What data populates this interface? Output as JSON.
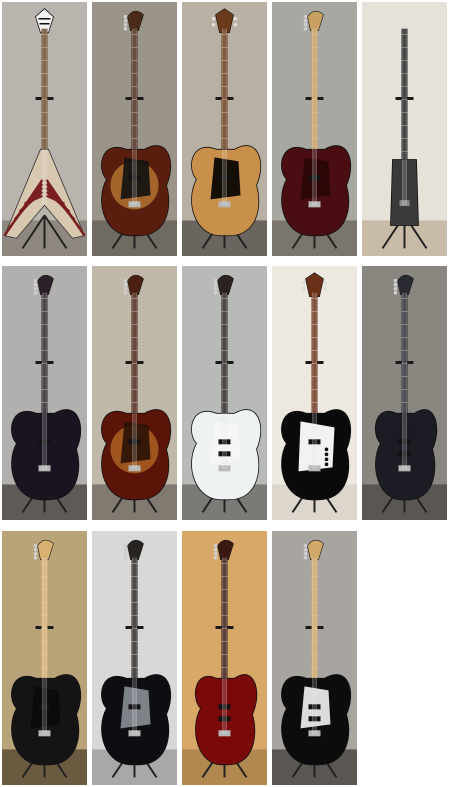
{
  "gallery": {
    "rows": [
      [
        {
          "id": "bass-1",
          "body": "flying-v",
          "finish": "#d8c8b0",
          "stripes": "#7a1f1f",
          "neck": "#6a4a2a",
          "head": "v",
          "bg": "#b9b4ad",
          "floor": "#8f8880"
        },
        {
          "id": "bass-2",
          "body": "p",
          "finish": "#5a1e0e",
          "burst": "#e0a040",
          "guard": "#111111",
          "neck": "#4a2a18",
          "head": "fender",
          "bg": "#9b9488",
          "floor": "#6f6a62"
        },
        {
          "id": "bass-3",
          "body": "carved",
          "finish": "#c8904a",
          "neck": "#6a3a1a",
          "head": "rick",
          "bg": "#b8b0a2",
          "floor": "#6a655e"
        },
        {
          "id": "bass-4",
          "body": "p",
          "finish": "#4a0e12",
          "guard": "#2a0608",
          "neck": "#c8a060",
          "head": "fender",
          "bg": "#a8a8a2",
          "floor": "#7a766e"
        },
        {
          "id": "bass-5",
          "body": "stick",
          "finish": "#3a3a3a",
          "neck": "#222222",
          "head": "none",
          "bg": "#e6e2da",
          "floor": "#c8bca8"
        }
      ],
      [
        {
          "id": "bass-6",
          "body": "p",
          "finish": "#1a1420",
          "guard": "#1a1420",
          "neck": "#2a2028",
          "head": "fender",
          "bg": "#b2b0ae",
          "floor": "#5e5a56"
        },
        {
          "id": "bass-7",
          "body": "p",
          "finish": "#5a1408",
          "burst": "#d88a30",
          "guard": "#2a1208",
          "neck": "#4a2010",
          "head": "fender",
          "bg": "#c0b8a8",
          "floor": "#807a70"
        },
        {
          "id": "bass-8",
          "body": "jazz",
          "finish": "#eef2f2",
          "guard": "#f6f6f6",
          "neck": "#2a2220",
          "head": "fender",
          "bg": "#b8bab8",
          "floor": "#7a7a76"
        },
        {
          "id": "bass-9",
          "body": "ricken",
          "finish": "#0a0a0a",
          "guard": "#f2f2f2",
          "neck": "#6a3018",
          "head": "rick",
          "bg": "#ede8e0",
          "floor": "#ddd6cc"
        },
        {
          "id": "bass-10",
          "body": "modern",
          "finish": "#1c1c24",
          "guard": "#1c1c24",
          "neck": "#2a2a32",
          "head": "fender",
          "bg": "#8a8680",
          "floor": "#5a5652"
        }
      ],
      [
        {
          "id": "bass-11",
          "body": "p",
          "finish": "#141414",
          "guard": "#0a0a0a",
          "neck": "#d8b070",
          "head": "fender",
          "bg": "#b8a478",
          "floor": "#6a5a40"
        },
        {
          "id": "bass-12",
          "body": "p",
          "finish": "#0e0e12",
          "guard": "#8a8e96",
          "neck": "#2a2420",
          "head": "fender",
          "bg": "#d8d8d8",
          "floor": "#a8a8a8"
        },
        {
          "id": "bass-13",
          "body": "modern",
          "finish": "#7a0a0a",
          "guard": "#7a0a0a",
          "neck": "#3a1a10",
          "head": "fender",
          "bg": "#d8a868",
          "floor": "#b08850"
        },
        {
          "id": "bass-14",
          "body": "jazz",
          "finish": "#0c0c0c",
          "guard": "#f2f2f2",
          "neck": "#d0a868",
          "head": "fender",
          "bg": "#a8a4a0",
          "floor": "#5a5652"
        }
      ]
    ]
  }
}
